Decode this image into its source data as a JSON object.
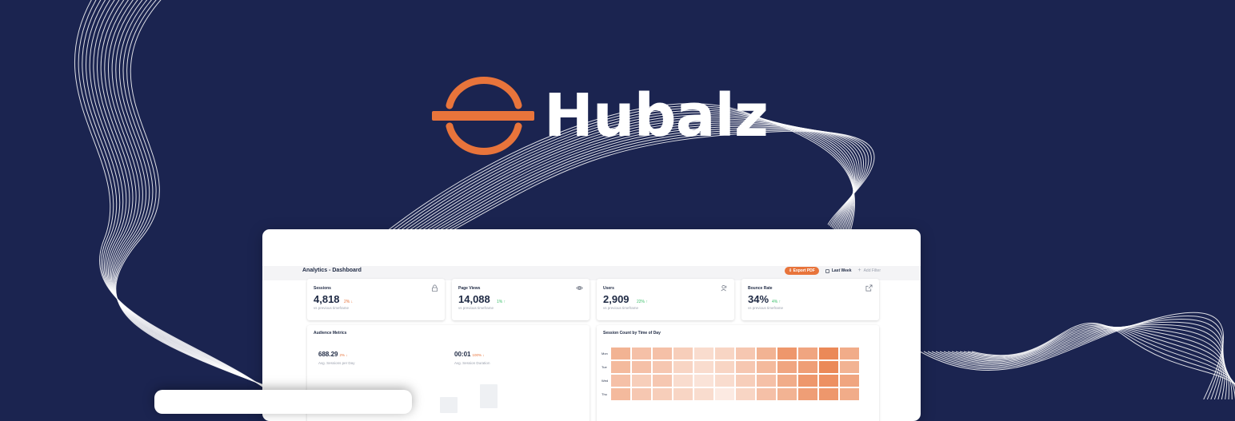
{
  "brand": {
    "name": "Hubalz",
    "accent": "#e8743b",
    "background": "#1b2450",
    "logo_icon": "hubalz-logo-icon"
  },
  "dashboard": {
    "title": "Analytics - Dashboard",
    "export_label": "Export PDF",
    "date_range_label": "Last Week",
    "add_filter_label": "Add Filter",
    "kpis": [
      {
        "label": "Sessions",
        "value": "4,818",
        "change": "2% ↓",
        "trend": "down",
        "sub": "vs previous timeframe",
        "icon": "lock-icon"
      },
      {
        "label": "Page Views",
        "value": "14,088",
        "change": "1% ↑",
        "trend": "up",
        "sub": "vs previous timeframe",
        "icon": "eye-icon"
      },
      {
        "label": "Users",
        "value": "2,909",
        "change": "22% ↑",
        "trend": "up",
        "sub": "vs previous timeframe",
        "icon": "user-icon"
      },
      {
        "label": "Bounce Rate",
        "value": "34%",
        "change": "4% ↑",
        "trend": "up",
        "sub": "vs previous timeframe",
        "icon": "external-link-icon"
      }
    ],
    "audience": {
      "title": "Audience Metrics",
      "metrics": [
        {
          "value": "688.29",
          "change": "2% ↓",
          "sub": "Avg. Sessions per Day"
        },
        {
          "value": "00:01",
          "change": "100% ↓",
          "sub": "Avg. Session Duration"
        }
      ]
    },
    "heatmap": {
      "title": "Session Count by Time of Day",
      "rows": [
        "Mon",
        "Tue",
        "Wed",
        "Thu"
      ],
      "color": "#e8743b",
      "intensity": [
        [
          0.55,
          0.45,
          0.45,
          0.35,
          0.25,
          0.3,
          0.4,
          0.55,
          0.75,
          0.65,
          0.85,
          0.6
        ],
        [
          0.5,
          0.45,
          0.4,
          0.3,
          0.25,
          0.3,
          0.4,
          0.5,
          0.65,
          0.7,
          0.85,
          0.55
        ],
        [
          0.45,
          0.35,
          0.4,
          0.25,
          0.2,
          0.25,
          0.35,
          0.45,
          0.6,
          0.75,
          0.8,
          0.65
        ],
        [
          0.5,
          0.4,
          0.35,
          0.3,
          0.25,
          0.15,
          0.3,
          0.45,
          0.55,
          0.7,
          0.75,
          0.6
        ]
      ]
    }
  }
}
